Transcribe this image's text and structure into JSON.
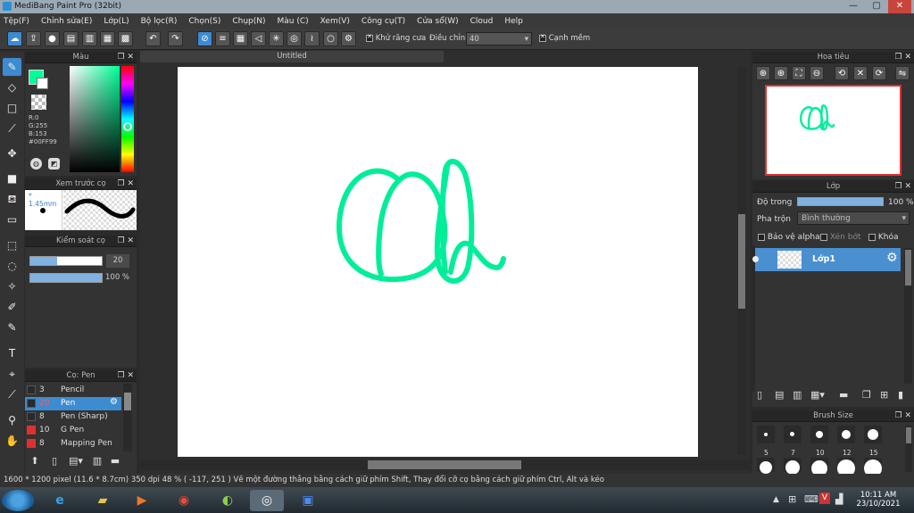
{
  "window": {
    "title": "MediBang Paint Pro (32bit)",
    "minimize": "—",
    "maximize": "▢",
    "close": "✕"
  },
  "menu": [
    "Tệp(F)",
    "Chỉnh sửa(E)",
    "Lớp(L)",
    "Bộ lọc(R)",
    "Chọn(S)",
    "Chụp(N)",
    "Màu (C)",
    "Xem(V)",
    "Công cụ(T)",
    "Cửa sổ(W)",
    "Cloud",
    "Help"
  ],
  "toolbar": {
    "antialias_label": "Khử răng cưa",
    "correction_label": "Điều chỉnh",
    "correction_value": "40",
    "sharp_edge_label": "Cạnh mềm"
  },
  "color_panel": {
    "title": "Màu",
    "r": "R:0",
    "g": "G:255",
    "b": "B:153",
    "hex": "#00FF99",
    "current_color": "#00FF99"
  },
  "brush_preview": {
    "title": "Xem trước cọ",
    "size": "1.45mm"
  },
  "brush_control": {
    "title": "Kiểm soát cọ",
    "size_value": "20",
    "opacity_value": "100 %"
  },
  "brush_list": {
    "title": "Cọ: Pen",
    "items": [
      {
        "size": "3",
        "name": "Pencil",
        "swatch": "#2a2a2a"
      },
      {
        "size": "20",
        "name": "Pen",
        "swatch": "#2a2a2a"
      },
      {
        "size": "8",
        "name": "Pen (Sharp)",
        "swatch": "#2a2a2a"
      },
      {
        "size": "10",
        "name": "G Pen",
        "swatch": "#e03030"
      },
      {
        "size": "8",
        "name": "Mapping Pen",
        "swatch": "#e03030"
      }
    ]
  },
  "document": {
    "tab": "Untitled"
  },
  "navigator": {
    "title": "Hoa tiêu"
  },
  "layer_panel": {
    "title": "Lớp",
    "opacity_label": "Độ trong",
    "opacity_value": "100 %",
    "blend_label": "Pha trộn",
    "blend_value": "Bình thường",
    "protect_alpha": "Bảo vệ alpha",
    "clipping": "Xén bớt",
    "lock": "Khóa",
    "layer_name": "Lớp1"
  },
  "brush_size_panel": {
    "title": "Brush Size",
    "sizes": [
      "5",
      "7",
      "10",
      "12",
      "15"
    ]
  },
  "status": {
    "text": "1600 * 1200 pixel   (11.6 * 8.7cm)   350 dpi   48 %   ( -117, 251 )   Vẽ một đường thẳng bằng cách giữ phím Shift, Thay đổi cỡ cọ bằng cách giữ phím Ctrl, Alt và kéo"
  },
  "taskbar": {
    "time": "10:11 AM",
    "date": "23/10/2021"
  }
}
